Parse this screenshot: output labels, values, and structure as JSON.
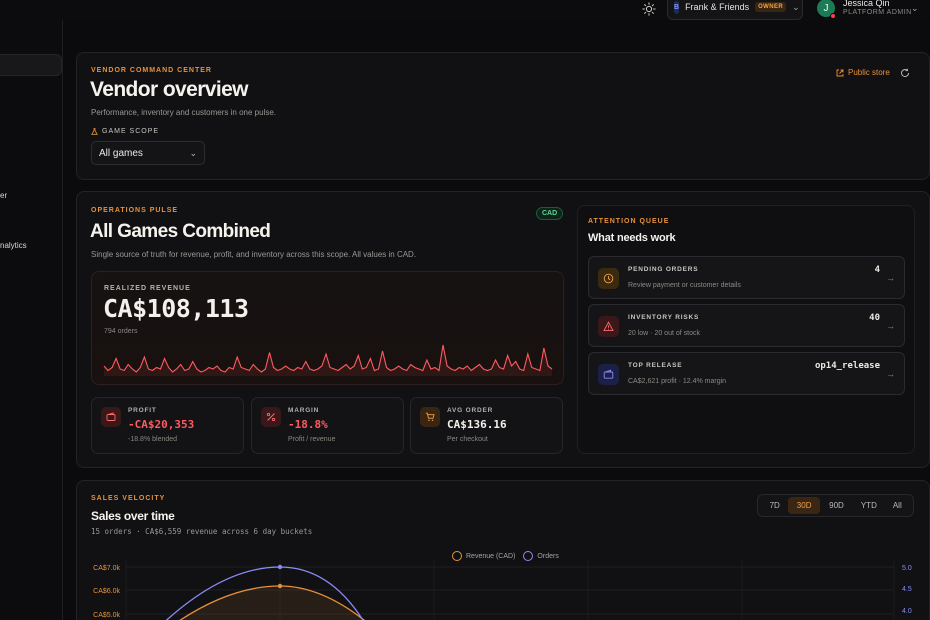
{
  "topbar": {
    "team_logo": "B",
    "team_name": "Frank & Friends",
    "team_badge": "OWNER",
    "user_initial": "J",
    "user_name": "Jessica Qin",
    "user_role": "PLATFORM ADMIN",
    "icons": [
      "sun-icon",
      "chevron-down-icon"
    ]
  },
  "sidebar": {
    "items": [
      {
        "label": "er"
      },
      {
        "label": "nalytics"
      }
    ]
  },
  "overview": {
    "eyebrow": "VENDOR COMMAND CENTER",
    "title": "Vendor overview",
    "subtitle": "Performance, inventory and customers in one pulse.",
    "public_store": "Public store",
    "scope_label": "GAME SCOPE",
    "scope_value": "All games"
  },
  "pulse": {
    "eyebrow": "OPERATIONS PULSE",
    "badge": "CAD",
    "title": "All Games Combined",
    "subtitle": "Single source of truth for revenue, profit, and inventory across this scope. All values in CAD.",
    "revenue_label": "REALIZED REVENUE",
    "revenue_value": "CA$108,113",
    "revenue_orders": "794 orders",
    "sparkline": [
      0.3,
      0.15,
      0.25,
      0.55,
      0.2,
      0.15,
      0.35,
      0.2,
      0.1,
      0.25,
      0.6,
      0.2,
      0.15,
      0.25,
      0.2,
      0.55,
      0.25,
      0.1,
      0.2,
      0.35,
      0.15,
      0.2,
      0.45,
      0.2,
      0.1,
      0.15,
      0.25,
      0.2,
      0.3,
      0.15,
      0.1,
      0.25,
      0.2,
      0.6,
      0.25,
      0.2,
      0.15,
      0.35,
      0.2,
      0.1,
      0.2,
      0.75,
      0.25,
      0.15,
      0.2,
      0.3,
      0.2,
      0.15,
      0.25,
      0.2,
      0.45,
      0.2,
      0.15,
      0.2,
      0.3,
      0.7,
      0.25,
      0.2,
      0.15,
      0.25,
      0.35,
      0.2,
      0.3,
      0.65,
      0.2,
      0.25,
      0.55,
      0.15,
      0.2,
      0.8,
      0.25,
      0.15,
      0.2,
      0.3,
      0.2,
      0.15,
      0.35,
      0.25,
      0.2,
      0.15,
      0.5,
      0.2,
      0.25,
      0.15,
      1.0,
      0.3,
      0.2,
      0.15,
      0.25,
      0.2,
      0.3,
      0.15,
      0.25,
      0.35,
      0.2,
      0.15,
      0.2,
      0.5,
      0.25,
      0.2,
      0.65,
      0.3,
      0.45,
      0.2,
      0.15,
      0.7,
      0.25,
      0.2,
      0.15,
      0.9,
      0.3,
      0.2
    ],
    "metrics": [
      {
        "label": "PROFIT",
        "value": "-CA$20,353",
        "sub": "-18.8% blended",
        "icon": "wallet-icon"
      },
      {
        "label": "MARGIN",
        "value": "-18.8%",
        "sub": "Profit / revenue",
        "icon": "percent-icon"
      },
      {
        "label": "AVG ORDER",
        "value": "CA$136.16",
        "sub": "Per checkout",
        "icon": "cart-icon"
      }
    ]
  },
  "queue": {
    "eyebrow": "ATTENTION QUEUE",
    "title": "What needs work",
    "items": [
      {
        "title": "PENDING ORDERS",
        "desc": "Review payment or customer details",
        "value": "4",
        "icon": "clock-icon"
      },
      {
        "title": "INVENTORY RISKS",
        "desc": "20 low · 20 out of stock",
        "value": "40",
        "icon": "warning-icon"
      },
      {
        "title": "TOP RELEASE",
        "desc": "CA$2,621 profit · 12.4% margin",
        "value": "op14_release",
        "icon": "wallet-icon"
      }
    ]
  },
  "velocity": {
    "eyebrow": "SALES VELOCITY",
    "title": "Sales over time",
    "subtitle": "15 orders · CA$6,559 revenue across 6 day buckets",
    "ranges": [
      "7D",
      "30D",
      "90D",
      "YTD",
      "All"
    ],
    "active_range": "30D"
  },
  "chart_data": {
    "type": "line",
    "series": [
      {
        "name": "Revenue (CAD)",
        "color": "#e8913a"
      },
      {
        "name": "Orders",
        "color": "#8a8cf5"
      }
    ],
    "y_left_ticks": [
      "CA$7.0k",
      "CA$6.0k",
      "CA$5.0k"
    ],
    "y_right_ticks": [
      "5.0",
      "4.5",
      "4.0"
    ]
  },
  "colors": {
    "accent": "#e8913a",
    "danger": "#ff5a5f",
    "success": "#5ad79a"
  }
}
